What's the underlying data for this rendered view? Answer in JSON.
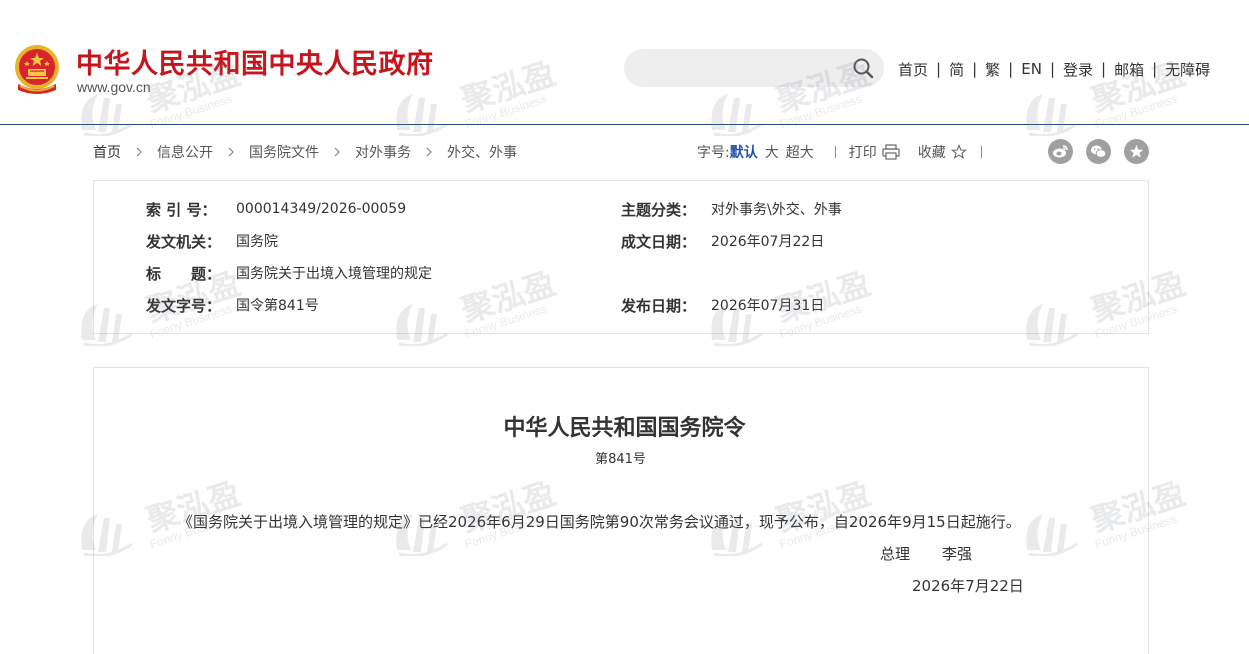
{
  "header": {
    "site_title": "中华人民共和国中央人民政府",
    "domain": "www.gov.cn",
    "search_placeholder": "",
    "nav": [
      "首页",
      "简",
      "繁",
      "EN",
      "登录",
      "邮箱",
      "无障碍"
    ],
    "nav_separator": "|"
  },
  "watermark": {
    "text_cn": "聚泓盈",
    "text_en": "Fonny Business"
  },
  "breadcrumb": [
    "首页",
    "信息公开",
    "国务院文件",
    "对外事务",
    "外交、外事"
  ],
  "tools": {
    "font_size_label": "字号:",
    "font_sizes": [
      "默认",
      "大",
      "超大"
    ],
    "active_font_size": "默认",
    "print_label": "打印",
    "favorite_label": "收藏",
    "share_icons": [
      "weibo-icon",
      "wechat-icon",
      "star-share-icon"
    ]
  },
  "info": {
    "index_label": "索 引 号：",
    "index_value": "000014349/2026-00059",
    "category_label": "主题分类：",
    "category_value": "对外事务\\外交、外事",
    "issuer_label": "发文机关：",
    "issuer_value": "国务院",
    "written_date_label": "成文日期：",
    "written_date_value": "2026年07月22日",
    "title_label": "标　　题：",
    "title_value": "国务院关于出境入境管理的规定",
    "doc_number_label": "发文字号：",
    "doc_number_value": "国令第841号",
    "publish_date_label": "发布日期：",
    "publish_date_value": "2026年07月31日"
  },
  "document": {
    "title": "中华人民共和国国务院令",
    "number": "第841号",
    "paragraph": "《国务院关于出境入境管理的规定》已经2026年6月29日国务院第90次常务会议通过，现予公布，自2026年9月15日起施行。",
    "signer_role": "总理",
    "signer_name": "李强",
    "date": "2026年7月22日"
  },
  "colors": {
    "brand_red": "#c5161d",
    "active_blue": "#2255a4",
    "header_rule": "#2a4a7a",
    "search_bg": "#eeeeee"
  }
}
